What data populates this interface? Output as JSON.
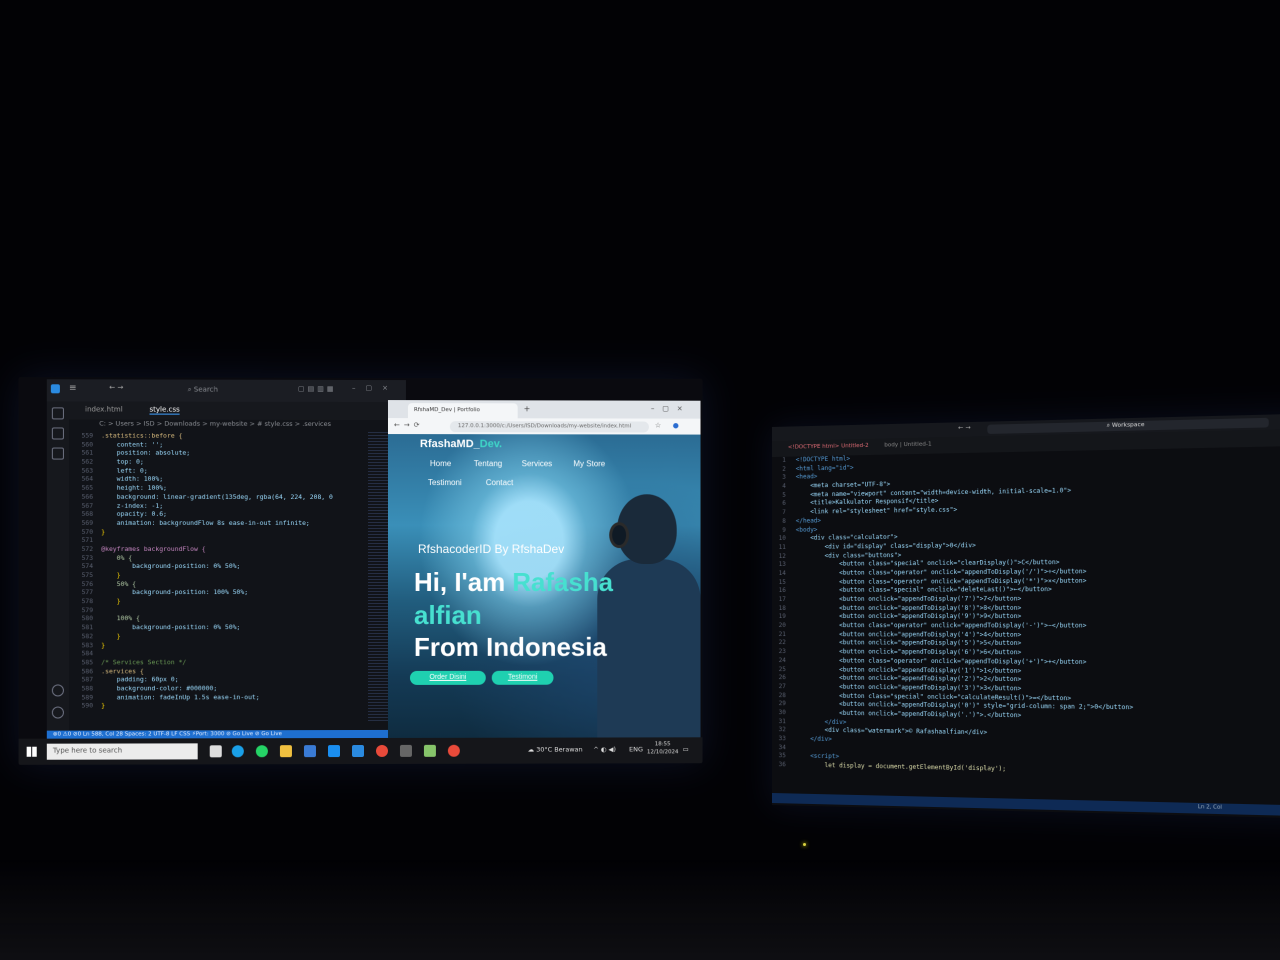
{
  "left_vscode": {
    "search": "Search",
    "tabs": [
      "index.html",
      "style.css"
    ],
    "breadcrumb": "C: > Users > ISD > Downloads > my-website > # style.css > .services",
    "code": [
      [
        "559",
        ".statistics::before {"
      ],
      [
        "560",
        "    content: '';"
      ],
      [
        "561",
        "    position: absolute;"
      ],
      [
        "562",
        "    top: 0;"
      ],
      [
        "563",
        "    left: 0;"
      ],
      [
        "564",
        "    width: 100%;"
      ],
      [
        "565",
        "    height: 100%;"
      ],
      [
        "566",
        "    background: linear-gradient(135deg, rgba(64, 224, 208, 0"
      ],
      [
        "567",
        "    z-index: -1;"
      ],
      [
        "568",
        "    opacity: 0.6;"
      ],
      [
        "569",
        "    animation: backgroundFlow 8s ease-in-out infinite;"
      ],
      [
        "570",
        "}"
      ],
      [
        "571",
        ""
      ],
      [
        "572",
        "@keyframes backgroundFlow {"
      ],
      [
        "573",
        "    0% {"
      ],
      [
        "574",
        "        background-position: 0% 50%;"
      ],
      [
        "575",
        "    }"
      ],
      [
        "576",
        "    50% {"
      ],
      [
        "577",
        "        background-position: 100% 50%;"
      ],
      [
        "578",
        "    }"
      ],
      [
        "579",
        ""
      ],
      [
        "580",
        "    100% {"
      ],
      [
        "581",
        "        background-position: 0% 50%;"
      ],
      [
        "582",
        "    }"
      ],
      [
        "583",
        "}"
      ],
      [
        "584",
        ""
      ],
      [
        "585",
        "/* Services Section */"
      ],
      [
        "586",
        ".services {"
      ],
      [
        "587",
        "    padding: 60px 0;"
      ],
      [
        "588",
        "    background-color: #000000;"
      ],
      [
        "589",
        "    animation: fadeInUp 1.5s ease-in-out;"
      ],
      [
        "590",
        "}"
      ]
    ],
    "status": "⊗0 ⚠0  ⊘0   Ln 588, Col 28   Spaces: 2   UTF-8   LF   CSS   ⚡Port: 3000   ⊘ Go Live   ⊘ Go Live"
  },
  "browser": {
    "tab_title": "RfshaMD_Dev | Portfolio",
    "url": "127.0.0.1:3000/c:/Users/ISD/Downloads/my-website/index.html",
    "logo_main": "RfashaMD_",
    "logo_accent": "Dev.",
    "nav": [
      "Home",
      "Tentang",
      "Services",
      "My Store",
      "Testimoni",
      "Contact"
    ],
    "hero_subtitle": "RfshacoderID By RfshaDev",
    "hero_line1_a": "Hi, I'am ",
    "hero_line1_b": "Rafasha",
    "hero_line2": "alfian",
    "hero_line3": "From Indonesia",
    "btn_order": "Order Disini",
    "btn_testimoni": "Testimoni"
  },
  "taskbar": {
    "search_placeholder": "Type here to search",
    "weather": "30°C  Berawan",
    "lang": "ENG",
    "time": "18:55",
    "date": "12/10/2024"
  },
  "right_vscode": {
    "search": "Workspace",
    "tabs": [
      "<!DOCTYPE html>  Untitled-2",
      "body | Untitled-1"
    ],
    "code": [
      [
        "1",
        "<!DOCTYPE html>"
      ],
      [
        "2",
        "<html lang=\"id\">"
      ],
      [
        "3",
        "<head>"
      ],
      [
        "4",
        "    <meta charset=\"UTF-8\">"
      ],
      [
        "5",
        "    <meta name=\"viewport\" content=\"width=device-width, initial-scale=1.0\">"
      ],
      [
        "6",
        "    <title>Kalkulator Responsif</title>"
      ],
      [
        "7",
        "    <link rel=\"stylesheet\" href=\"style.css\">"
      ],
      [
        "8",
        "</head>"
      ],
      [
        "9",
        "<body>"
      ],
      [
        "10",
        "    <div class=\"calculator\">"
      ],
      [
        "11",
        "        <div id=\"display\" class=\"display\">0</div>"
      ],
      [
        "12",
        "        <div class=\"buttons\">"
      ],
      [
        "13",
        "            <button class=\"special\" onclick=\"clearDisplay()\">C</button>"
      ],
      [
        "14",
        "            <button class=\"operator\" onclick=\"appendToDisplay('/')\">÷</button>"
      ],
      [
        "15",
        "            <button class=\"operator\" onclick=\"appendToDisplay('*')\">×</button>"
      ],
      [
        "16",
        "            <button class=\"special\" onclick=\"deleteLast()\">←</button>"
      ],
      [
        "17",
        "            <button onclick=\"appendToDisplay('7')\">7</button>"
      ],
      [
        "18",
        "            <button onclick=\"appendToDisplay('8')\">8</button>"
      ],
      [
        "19",
        "            <button onclick=\"appendToDisplay('9')\">9</button>"
      ],
      [
        "20",
        "            <button class=\"operator\" onclick=\"appendToDisplay('-')\">−</button>"
      ],
      [
        "21",
        "            <button onclick=\"appendToDisplay('4')\">4</button>"
      ],
      [
        "22",
        "            <button onclick=\"appendToDisplay('5')\">5</button>"
      ],
      [
        "23",
        "            <button onclick=\"appendToDisplay('6')\">6</button>"
      ],
      [
        "24",
        "            <button class=\"operator\" onclick=\"appendToDisplay('+')\">+</button>"
      ],
      [
        "25",
        "            <button onclick=\"appendToDisplay('1')\">1</button>"
      ],
      [
        "26",
        "            <button onclick=\"appendToDisplay('2')\">2</button>"
      ],
      [
        "27",
        "            <button onclick=\"appendToDisplay('3')\">3</button>"
      ],
      [
        "28",
        "            <button class=\"special\" onclick=\"calculateResult()\">=</button>"
      ],
      [
        "29",
        "            <button onclick=\"appendToDisplay('0')\" style=\"grid-column: span 2;\">0</button>"
      ],
      [
        "30",
        "            <button onclick=\"appendToDisplay('.')\">.</button>"
      ],
      [
        "31",
        "        </div>"
      ],
      [
        "32",
        "        <div class=\"watermark\">© Rafashaalfian</div>"
      ],
      [
        "33",
        "    </div>"
      ],
      [
        "34",
        ""
      ],
      [
        "35",
        "    <script>"
      ],
      [
        "36",
        "        let display = document.getElementById('display');"
      ]
    ],
    "status": "Ln 2, Col"
  }
}
